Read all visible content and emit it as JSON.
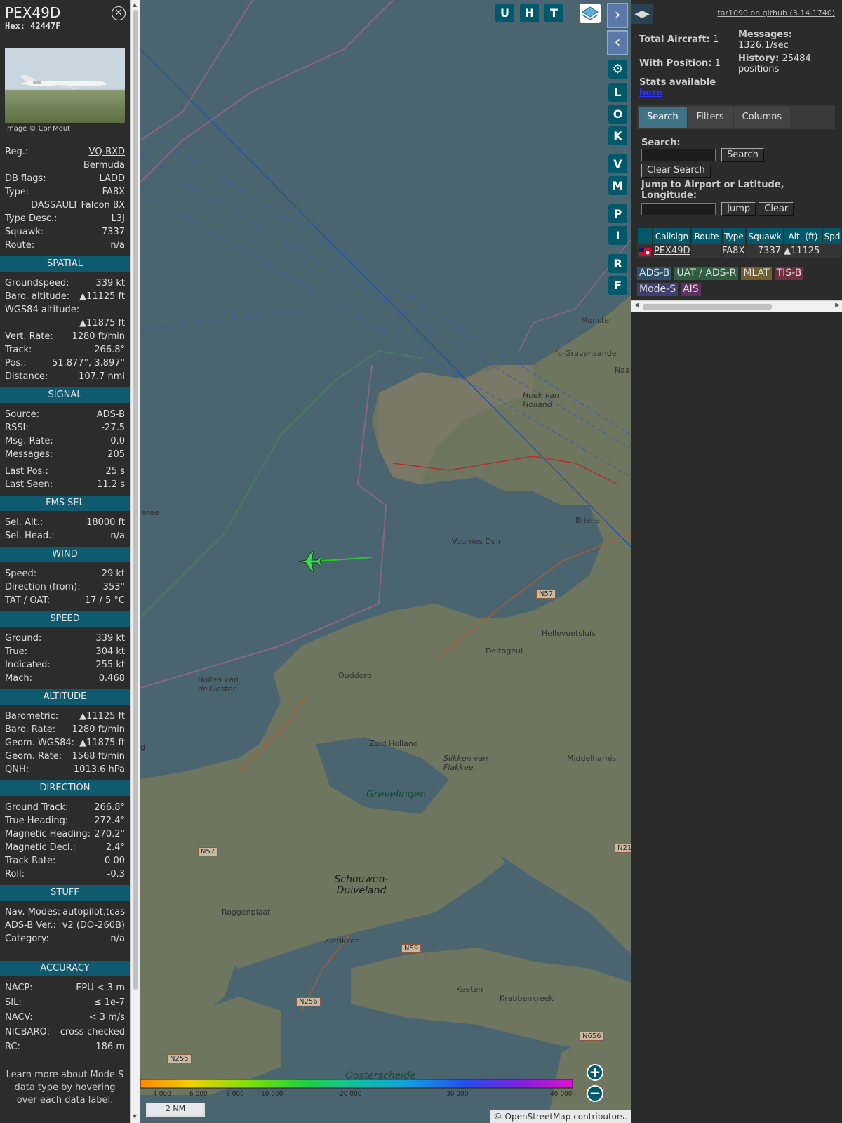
{
  "sidebar": {
    "callsign": "PEX49D",
    "hex_label": "Hex:",
    "hex": "42447F",
    "image_credit": "Image © Cor Mout",
    "info": [
      {
        "label": "Reg.:",
        "value": "VQ-BXD",
        "link": true
      },
      {
        "label": "",
        "value": "Bermuda"
      },
      {
        "label": "DB flags:",
        "value": "LADD",
        "link": true
      },
      {
        "label": "Type:",
        "value": "FA8X"
      },
      {
        "label": "",
        "value": "DASSAULT Falcon 8X"
      },
      {
        "label": "Type Desc.:",
        "value": "L3J"
      },
      {
        "label": "Squawk:",
        "value": "7337"
      },
      {
        "label": "Route:",
        "value": "n/a"
      }
    ],
    "sections": [
      {
        "title": "SPATIAL",
        "rows": [
          {
            "label": "Groundspeed:",
            "value": "339 kt"
          },
          {
            "label": "Baro. altitude:",
            "value": "▲11125 ft"
          },
          {
            "label": "WGS84 altitude:",
            "value": ""
          },
          {
            "label": "",
            "value": "▲11875 ft"
          },
          {
            "label": "Vert. Rate:",
            "value": "1280 ft/min"
          },
          {
            "label": "Track:",
            "value": "266.8°"
          },
          {
            "label": "Pos.:",
            "value": "51.877°, 3.897°"
          },
          {
            "label": "Distance:",
            "value": "107.7 nmi"
          }
        ]
      },
      {
        "title": "SIGNAL",
        "rows": [
          {
            "label": "Source:",
            "value": "ADS-B"
          },
          {
            "label": "RSSI:",
            "value": "-27.5"
          },
          {
            "label": "Msg. Rate:",
            "value": "0.0"
          },
          {
            "label": "Messages:",
            "value": "205"
          },
          {
            "label": "Last Pos.:",
            "value": "25 s"
          },
          {
            "label": "Last Seen:",
            "value": "11.2 s"
          }
        ]
      },
      {
        "title": "FMS SEL",
        "rows": [
          {
            "label": "Sel. Alt.:",
            "value": "18000 ft"
          },
          {
            "label": "Sel. Head.:",
            "value": "n/a"
          }
        ]
      },
      {
        "title": "WIND",
        "rows": [
          {
            "label": "Speed:",
            "value": "29 kt"
          },
          {
            "label": "Direction (from):",
            "value": "353°"
          },
          {
            "label": "TAT / OAT:",
            "value": "17 / 5 °C"
          }
        ]
      },
      {
        "title": "SPEED",
        "rows": [
          {
            "label": "Ground:",
            "value": "339 kt"
          },
          {
            "label": "True:",
            "value": "304 kt"
          },
          {
            "label": "Indicated:",
            "value": "255 kt"
          },
          {
            "label": "Mach:",
            "value": "0.468"
          }
        ]
      },
      {
        "title": "ALTITUDE",
        "rows": [
          {
            "label": "Barometric:",
            "value": "▲11125 ft"
          },
          {
            "label": "Baro. Rate:",
            "value": "1280 ft/min"
          },
          {
            "label": "Geom. WGS84:",
            "value": "▲11875 ft"
          },
          {
            "label": "Geom. Rate:",
            "value": "1568 ft/min"
          },
          {
            "label": "QNH:",
            "value": "1013.6 hPa"
          }
        ]
      },
      {
        "title": "DIRECTION",
        "rows": [
          {
            "label": "Ground Track:",
            "value": "266.8°"
          },
          {
            "label": "True Heading:",
            "value": "272.4°"
          },
          {
            "label": "Magnetic Heading:",
            "value": "270.2°"
          },
          {
            "label": "Magnetic Decl.:",
            "value": "2.4°"
          },
          {
            "label": "Track Rate:",
            "value": "0.00"
          },
          {
            "label": "Roll:",
            "value": "-0.3"
          }
        ]
      },
      {
        "title": "STUFF",
        "rows": [
          {
            "label": "Nav. Modes:",
            "value": "autopilot,tcas"
          },
          {
            "label": "ADS-B Ver.:",
            "value": "v2 (DO-260B)"
          },
          {
            "label": "Category:",
            "value": "n/a"
          }
        ]
      },
      {
        "title": "ACCURACY",
        "rows": [
          {
            "label": "NACP:",
            "value": "EPU < 3 m"
          },
          {
            "label": "SIL:",
            "value": "≤ 1e-7"
          },
          {
            "label": "NACV:",
            "value": "< 3 m/s"
          },
          {
            "label": "NICBARO:",
            "value": "cross-checked"
          },
          {
            "label": "RC:",
            "value": "186 m"
          }
        ]
      }
    ],
    "note": "Learn more about Mode S data type by hovering over each data label."
  },
  "map": {
    "top_buttons": [
      "U",
      "H",
      "T"
    ],
    "side_buttons": [
      "L",
      "O",
      "K",
      "V",
      "M",
      "P",
      "I",
      "R",
      "F"
    ],
    "labels": [
      {
        "text": "Monster"
      },
      {
        "text": "'s-Gravenzande"
      },
      {
        "text": "Naal"
      },
      {
        "text": "Hoek van Holland"
      },
      {
        "text": "Brielle"
      },
      {
        "text": "Voornes Duin"
      },
      {
        "text": "N57"
      },
      {
        "text": "Hellevoetsluis"
      },
      {
        "text": "Deltageul"
      },
      {
        "text": "Ouddorp"
      },
      {
        "text": "Bollen van de Ooster"
      },
      {
        "text": "Zuid Holland"
      },
      {
        "text": "Slikken van Flakkee"
      },
      {
        "text": "Middelharnis"
      },
      {
        "text": "Grevelingen"
      },
      {
        "text": "N57"
      },
      {
        "text": "N21"
      },
      {
        "text": "Schouwen-Duiveland"
      },
      {
        "text": "Roggenplaat"
      },
      {
        "text": "Zierikzee"
      },
      {
        "text": "N59"
      },
      {
        "text": "Keeten"
      },
      {
        "text": "Krabbenkreek"
      },
      {
        "text": "N256"
      },
      {
        "text": "N656"
      },
      {
        "text": "N255"
      },
      {
        "text": "Oosterschelde"
      },
      {
        "text": "eree"
      },
      {
        "text": "g"
      }
    ],
    "scale_bar": "2 NM",
    "colorbar_ticks": [
      "4 000",
      "6 000",
      "8 000",
      "10 000",
      "20 000",
      "30 000",
      "40 000+"
    ],
    "attribution_prefix": "© ",
    "attribution_link": "OpenStreetMap",
    "attribution_suffix": " contributors.",
    "zoom_in": "+",
    "zoom_out": "−"
  },
  "right": {
    "github": "tar1090 on github (3.14.1740)",
    "total_aircraft_label": "Total Aircraft:",
    "total_aircraft": "1",
    "messages_label": "Messages:",
    "messages": "1326.1/sec",
    "with_position_label": "With Position:",
    "with_position": "1",
    "history_label": "History:",
    "history": "25484",
    "history_unit": "positions",
    "stats_text": "Stats available",
    "stats_link": "here",
    "tabs": [
      "Search",
      "Filters",
      "Columns"
    ],
    "search_label": "Search:",
    "search_button": "Search",
    "clear_search": "Clear Search",
    "jump_label": "Jump to Airport or Latitude, Longitude:",
    "jump_button": "Jump",
    "clear_button": "Clear",
    "table_headers": [
      "",
      "Callsign",
      "Route",
      "Type",
      "Squawk",
      "Alt. (ft)",
      "Spd"
    ],
    "table_row": {
      "callsign": "PEX49D",
      "route": "",
      "type": "FA8X",
      "squawk": "7337",
      "alt": "▲11125",
      "spd": ""
    },
    "legend": [
      {
        "text": "ADS-B",
        "color": "#2f4f6f"
      },
      {
        "text": "UAT / ADS-R",
        "color": "#2f5f3f"
      },
      {
        "text": "MLAT",
        "color": "#6f5f2f"
      },
      {
        "text": "TIS-B",
        "color": "#6f2f3f"
      },
      {
        "text": "Mode-S",
        "color": "#3f3f6f"
      },
      {
        "text": "AIS",
        "color": "#5f2f5f"
      }
    ]
  }
}
